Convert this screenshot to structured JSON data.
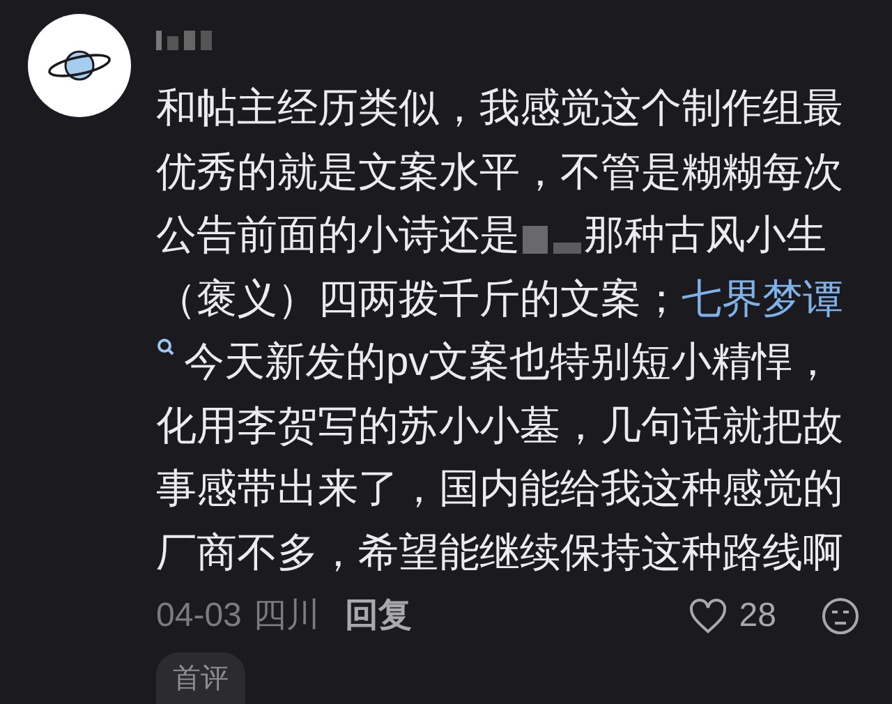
{
  "comment": {
    "body": [
      {
        "kind": "text",
        "text": "和帖主经历类似，我感觉这个制作组最优秀的就是文案水平，不管是糊糊每次公告前面的小诗还是"
      },
      {
        "kind": "redacted"
      },
      {
        "kind": "text",
        "text": "那种古风小生（褒义）四两拨千斤的文案；"
      },
      {
        "kind": "link",
        "text": "七界梦谭"
      },
      {
        "kind": "search"
      },
      {
        "kind": "text",
        "text": "今天新发的pv文案也特别短小精悍，化用李贺写的苏小小墓，几句话就把故事感带出来了，国内能给我这种感觉的厂商不多，希望能继续保持这种路线啊"
      }
    ],
    "date": "04-03",
    "location": "四川",
    "reply": "回复",
    "likes": "28",
    "liked": false,
    "badge": "首评"
  }
}
